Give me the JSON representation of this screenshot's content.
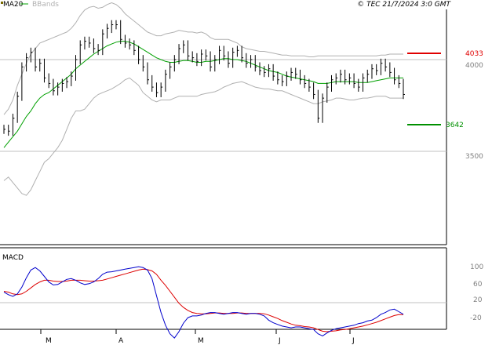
{
  "header": {
    "ma_label": "MA20",
    "bb_label": "BBands",
    "copyright": "© TEC 21/7/2024 3:0 GMT"
  },
  "colors": {
    "price": "#000000",
    "ma20": "#00a000",
    "bbands": "#b0b0b0",
    "resistance": "#e00000",
    "support": "#009000",
    "macd": "#0000cc",
    "signal": "#dd0000",
    "grid": "#c0c0c0",
    "frame": "#000000"
  },
  "months": [
    "M",
    "A",
    "M",
    "J",
    "J"
  ],
  "price_panel": {
    "y_ticks": [
      "4000",
      "3500"
    ],
    "resistance": {
      "value": 4033,
      "label": "4033"
    },
    "support": {
      "value": 3642,
      "label": "3642"
    }
  },
  "macd_panel": {
    "title": "MACD",
    "y_ticks": [
      "100",
      "60",
      "20",
      "-20"
    ]
  },
  "chart_data": {
    "type": "line",
    "x_start_date": "2024-02-26",
    "price": [
      3620,
      3610,
      3680,
      3800,
      3960,
      4010,
      4040,
      3960,
      3980,
      3900,
      3870,
      3830,
      3850,
      3870,
      3880,
      3910,
      4000,
      4080,
      4100,
      4090,
      4060,
      4050,
      4140,
      4170,
      4190,
      4190,
      4110,
      4090,
      4080,
      4050,
      4000,
      3960,
      3890,
      3850,
      3820,
      3850,
      3920,
      3960,
      4000,
      4060,
      4080,
      4020,
      4010,
      3990,
      4030,
      4020,
      3960,
      4000,
      4050,
      4020,
      3980,
      4040,
      4050,
      4010,
      3980,
      4000,
      3960,
      3940,
      3930,
      3950,
      3910,
      3890,
      3880,
      3910,
      3930,
      3920,
      3890,
      3870,
      3850,
      3810,
      3680,
      3790,
      3850,
      3890,
      3900,
      3920,
      3890,
      3900,
      3870,
      3850,
      3900,
      3920,
      3950,
      3940,
      3980,
      3960,
      3930,
      3890,
      3870,
      3810
    ],
    "ma20": [
      3520,
      3550,
      3580,
      3610,
      3650,
      3690,
      3720,
      3760,
      3790,
      3810,
      3820,
      3840,
      3860,
      3880,
      3900,
      3920,
      3950,
      3970,
      3990,
      4010,
      4030,
      4045,
      4060,
      4075,
      4085,
      4095,
      4100,
      4100,
      4095,
      4085,
      4070,
      4055,
      4040,
      4025,
      4010,
      4000,
      3990,
      3985,
      3985,
      3990,
      3995,
      3995,
      3990,
      3985,
      3985,
      3990,
      3990,
      3995,
      4000,
      4005,
      4005,
      4000,
      4000,
      3995,
      3990,
      3980,
      3970,
      3960,
      3950,
      3940,
      3935,
      3930,
      3920,
      3910,
      3905,
      3900,
      3895,
      3890,
      3885,
      3880,
      3870,
      3870,
      3870,
      3875,
      3880,
      3880,
      3880,
      3880,
      3880,
      3875,
      3875,
      3875,
      3880,
      3885,
      3890,
      3895,
      3900,
      3900,
      3900,
      3900
    ],
    "bb_upper": [
      3700,
      3730,
      3780,
      3860,
      3920,
      3980,
      4030,
      4060,
      4090,
      4100,
      4110,
      4120,
      4130,
      4140,
      4150,
      4170,
      4200,
      4240,
      4270,
      4285,
      4290,
      4280,
      4285,
      4300,
      4310,
      4300,
      4280,
      4250,
      4230,
      4210,
      4190,
      4170,
      4150,
      4140,
      4130,
      4130,
      4140,
      4145,
      4150,
      4160,
      4155,
      4150,
      4150,
      4145,
      4150,
      4140,
      4120,
      4110,
      4110,
      4110,
      4110,
      4100,
      4090,
      4070,
      4060,
      4055,
      4050,
      4045,
      4045,
      4040,
      4035,
      4030,
      4025,
      4025,
      4020,
      4020,
      4020,
      4020,
      4015,
      4015,
      4020,
      4020,
      4020,
      4020,
      4020,
      4020,
      4020,
      4020,
      4020,
      4020,
      4020,
      4020,
      4020,
      4020,
      4025,
      4025,
      4030,
      4030,
      4030,
      4030
    ],
    "bb_lower": [
      3340,
      3360,
      3330,
      3300,
      3270,
      3260,
      3290,
      3340,
      3390,
      3440,
      3460,
      3490,
      3520,
      3560,
      3620,
      3680,
      3720,
      3720,
      3730,
      3760,
      3790,
      3810,
      3820,
      3830,
      3840,
      3855,
      3870,
      3890,
      3900,
      3880,
      3860,
      3820,
      3800,
      3780,
      3770,
      3780,
      3780,
      3780,
      3790,
      3800,
      3800,
      3800,
      3800,
      3800,
      3810,
      3815,
      3820,
      3825,
      3835,
      3850,
      3860,
      3870,
      3875,
      3880,
      3870,
      3860,
      3850,
      3845,
      3840,
      3840,
      3835,
      3830,
      3830,
      3820,
      3810,
      3800,
      3790,
      3780,
      3770,
      3760,
      3760,
      3770,
      3775,
      3780,
      3790,
      3790,
      3785,
      3780,
      3780,
      3785,
      3790,
      3790,
      3795,
      3800,
      3800,
      3800,
      3790,
      3790,
      3790,
      3790
    ],
    "macd": [
      38,
      32,
      28,
      34,
      50,
      72,
      90,
      96,
      88,
      75,
      62,
      55,
      56,
      62,
      68,
      70,
      66,
      60,
      56,
      58,
      62,
      70,
      80,
      85,
      86,
      88,
      90,
      92,
      94,
      96,
      98,
      96,
      90,
      70,
      30,
      -10,
      -40,
      -60,
      -70,
      -55,
      -35,
      -22,
      -18,
      -18,
      -16,
      -12,
      -10,
      -10,
      -12,
      -14,
      -12,
      -10,
      -10,
      -12,
      -14,
      -12,
      -12,
      -14,
      -18,
      -28,
      -34,
      -38,
      -42,
      -44,
      -46,
      -44,
      -44,
      -46,
      -48,
      -50,
      -60,
      -65,
      -58,
      -52,
      -48,
      -46,
      -44,
      -42,
      -40,
      -36,
      -34,
      -30,
      -28,
      -22,
      -14,
      -10,
      -4,
      -2,
      -8,
      -14
    ],
    "signal": [
      40,
      38,
      34,
      32,
      34,
      40,
      48,
      56,
      62,
      66,
      66,
      64,
      63,
      63,
      64,
      66,
      66,
      66,
      65,
      64,
      64,
      65,
      66,
      69,
      72,
      75,
      78,
      81,
      84,
      87,
      90,
      92,
      91,
      88,
      80,
      66,
      54,
      40,
      26,
      12,
      2,
      -5,
      -10,
      -12,
      -13,
      -13,
      -12,
      -11,
      -11,
      -12,
      -12,
      -12,
      -11,
      -11,
      -12,
      -12,
      -12,
      -12,
      -13,
      -16,
      -20,
      -24,
      -29,
      -33,
      -37,
      -40,
      -41,
      -43,
      -44,
      -46,
      -50,
      -54,
      -55,
      -54,
      -53,
      -51,
      -50,
      -48,
      -46,
      -44,
      -42,
      -39,
      -36,
      -33,
      -29,
      -25,
      -21,
      -17,
      -15,
      -15
    ]
  }
}
